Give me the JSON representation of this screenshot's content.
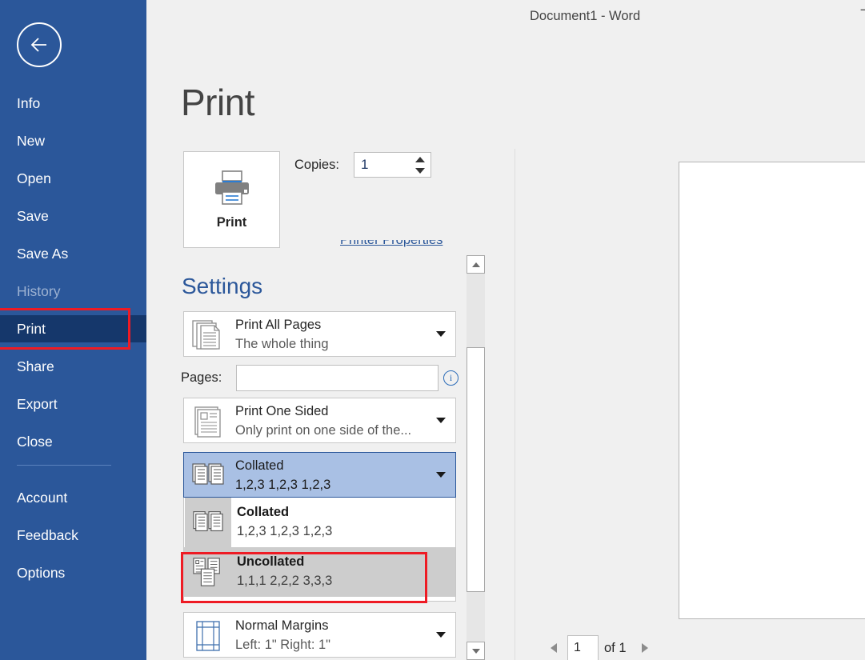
{
  "window": {
    "title": "Document1  -  Word",
    "titlebar_glyph": "⊤"
  },
  "nav": {
    "back_icon": "back-arrow-icon",
    "items": [
      {
        "label": "Info",
        "state": "normal"
      },
      {
        "label": "New",
        "state": "normal"
      },
      {
        "label": "Open",
        "state": "normal"
      },
      {
        "label": "Save",
        "state": "normal"
      },
      {
        "label": "Save As",
        "state": "normal"
      },
      {
        "label": "History",
        "state": "disabled"
      },
      {
        "label": "Print",
        "state": "active"
      },
      {
        "label": "Share",
        "state": "normal"
      },
      {
        "label": "Export",
        "state": "normal"
      },
      {
        "label": "Close",
        "state": "normal"
      },
      {
        "label": "Account",
        "state": "normal"
      },
      {
        "label": "Feedback",
        "state": "normal"
      },
      {
        "label": "Options",
        "state": "normal"
      }
    ]
  },
  "page": {
    "heading": "Print"
  },
  "print_button": {
    "label": "Print",
    "icon": "printer-icon"
  },
  "copies": {
    "label": "Copies:",
    "value": "1"
  },
  "printer_properties": {
    "link_label": "Printer Properties"
  },
  "settings": {
    "heading": "Settings",
    "print_range": {
      "title": "Print All Pages",
      "subtitle": "The whole thing",
      "icon": "pages-stack-icon"
    },
    "pages": {
      "label": "Pages:",
      "value": "",
      "placeholder": "",
      "info_glyph": "i"
    },
    "sides": {
      "title": "Print One Sided",
      "subtitle": "Only print on one side of the...",
      "icon": "one-sided-page-icon"
    },
    "collation": {
      "title": "Collated",
      "subtitle": "1,2,3   1,2,3   1,2,3",
      "icon": "collated-icon",
      "options": [
        {
          "title": "Collated",
          "subtitle": "1,2,3   1,2,3   1,2,3",
          "icon": "collated-icon",
          "state": "selected"
        },
        {
          "title": "Uncollated",
          "subtitle": "1,1,1   2,2,2   3,3,3",
          "icon": "uncollated-icon",
          "state": "hover"
        }
      ]
    },
    "margins": {
      "title": "Normal Margins",
      "subtitle": "Left:  1\"   Right:  1\"",
      "icon": "margins-grid-icon"
    }
  },
  "preview": {
    "current_page": "1",
    "of_label": "of 1",
    "prev_icon": "triangle-left-icon",
    "next_icon": "triangle-right-icon"
  },
  "colors": {
    "backstage_blue": "#2b579a",
    "backstage_active": "#15376b",
    "annotation_red": "#ee1b24",
    "selected_combo": "#a9c0e4",
    "hover_gray": "#cdcdcd"
  }
}
